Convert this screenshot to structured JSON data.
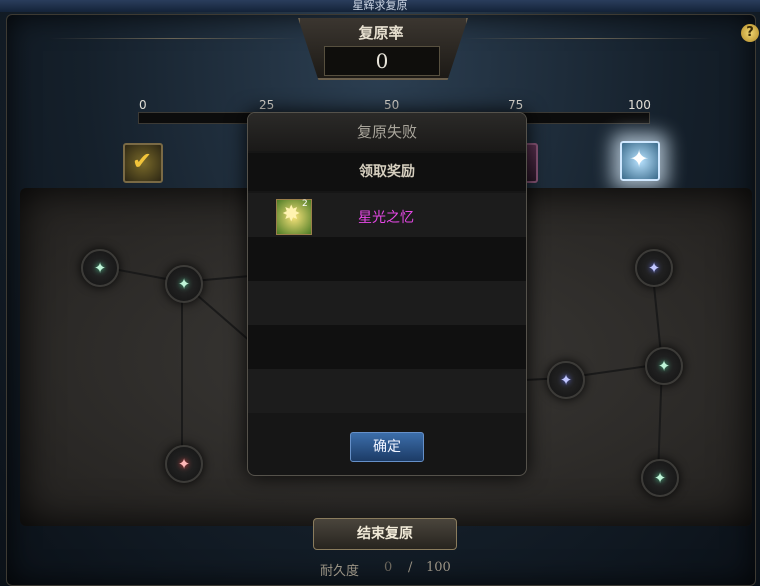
{
  "window": {
    "title": "星辉求复原"
  },
  "header": {
    "rate_label": "复原率",
    "rate_value": "0"
  },
  "progress": {
    "ticks": [
      "0",
      "25",
      "50",
      "75",
      "100"
    ],
    "value": 0
  },
  "colors": {
    "node_green": "#4fe0a0",
    "node_red": "#ff4040",
    "node_blue": "#6070ff",
    "reward_name": "#e648e6",
    "confirm_button": "#2a5590"
  },
  "board": {
    "end_button_label": "结束复原",
    "durability_label": "耐久度",
    "durability_current": "0",
    "durability_separator": "/",
    "durability_max": "100"
  },
  "modal": {
    "title": "复原失败",
    "subtitle": "领取奖励",
    "reward": {
      "count": "2",
      "name": "星光之忆",
      "icon": "starlight-memory-icon"
    },
    "confirm_label": "确定"
  },
  "icons": [
    "help-icon",
    "gold-check-tier-icon",
    "pink-tier-icon",
    "star-crystal-tier-icon"
  ]
}
